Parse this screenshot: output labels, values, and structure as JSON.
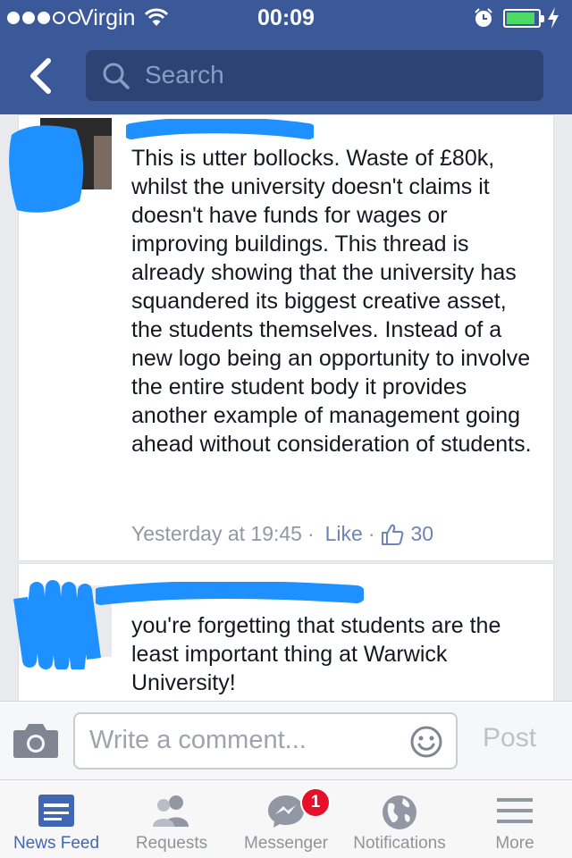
{
  "status_bar": {
    "carrier": "Virgin",
    "time": "00:09",
    "signal_bars_filled": 3,
    "signal_bars_total": 5,
    "battery_level": 0.9
  },
  "nav": {
    "search_placeholder": "Search"
  },
  "comments": [
    {
      "text": "This is utter bollocks. Waste of £80k, whilst the university doesn't claims it doesn't have funds for wages or improving buildings. This thread is already showing that the university has squandered its biggest creative asset, the students themselves. Instead of a new logo being an opportunity to involve the entire student body it provides another example of management going ahead without consideration of students.",
      "timestamp": "Yesterday at 19:45",
      "like_label": "Like",
      "like_count": "30"
    },
    {
      "text": "you're forgetting that students are the least important thing at Warwick University!"
    }
  ],
  "composer": {
    "placeholder": "Write a comment...",
    "post_label": "Post"
  },
  "tabs": [
    {
      "label": "News Feed",
      "icon": "news-feed-icon",
      "active": true
    },
    {
      "label": "Requests",
      "icon": "friend-requests-icon"
    },
    {
      "label": "Messenger",
      "icon": "messenger-icon",
      "badge": "1"
    },
    {
      "label": "Notifications",
      "icon": "globe-icon"
    },
    {
      "label": "More",
      "icon": "menu-icon"
    }
  ],
  "colors": {
    "brand_blue": "#3b5998",
    "redaction_blue": "#1e90ff",
    "badge_red": "#e6102b"
  }
}
